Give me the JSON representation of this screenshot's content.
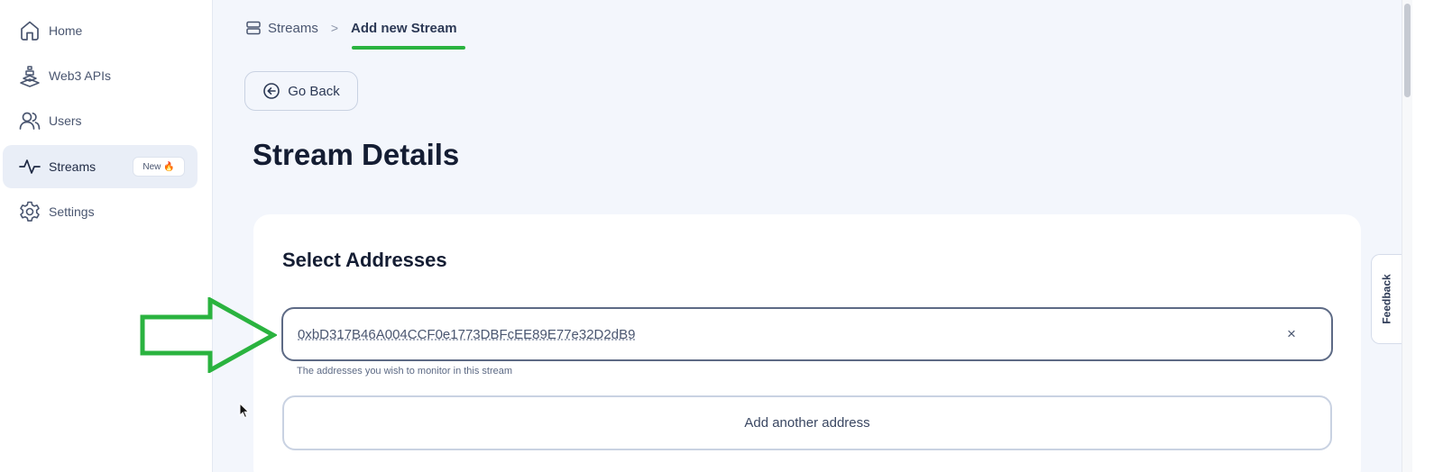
{
  "sidebar": {
    "items": [
      {
        "label": "Home",
        "icon": "home-icon",
        "active": false
      },
      {
        "label": "Web3 APIs",
        "icon": "blocks-icon",
        "active": false
      },
      {
        "label": "Users",
        "icon": "users-icon",
        "active": false
      },
      {
        "label": "Streams",
        "icon": "activity-icon",
        "active": true,
        "badge": "New 🔥"
      },
      {
        "label": "Settings",
        "icon": "gear-icon",
        "active": false
      }
    ]
  },
  "breadcrumb": {
    "root": "Streams",
    "separator": ">",
    "current": "Add new Stream"
  },
  "back_button": {
    "label": "Go Back",
    "icon": "circle-arrow-left-icon"
  },
  "page_title": "Stream Details",
  "card": {
    "title": "Select Addresses",
    "address_field": {
      "value": "0xbD317B46A004CCF0e1773DBFcEE89E77e32D2dB9",
      "clear_label": "×",
      "helper": "The addresses you wish to monitor in this stream"
    },
    "add_button_label": "Add another address"
  },
  "feedback_label": "Feedback",
  "colors": {
    "annotation": "#2ab33f",
    "background": "#f3f6fc",
    "active_nav": "#e9eef7"
  }
}
